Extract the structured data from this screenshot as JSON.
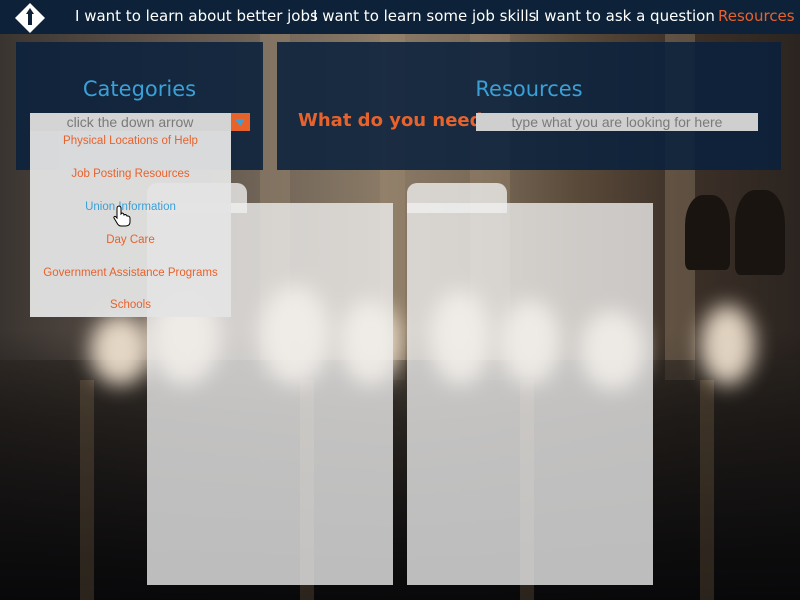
{
  "nav": {
    "items": [
      {
        "label": "I want to learn about better jobs"
      },
      {
        "label": "I want to learn some job skills"
      },
      {
        "label": "I want to ask a question"
      },
      {
        "label": "Resources"
      }
    ],
    "active_color": "#e8622c"
  },
  "categories": {
    "title": "Categories",
    "select_placeholder": "click the down arrow",
    "options": [
      "Physical Locations of Help",
      "Job Posting Resources",
      "Union Information",
      "Day Care",
      "Government Assistance Programs",
      "Schools"
    ],
    "hovered_option": "Union Information"
  },
  "resources": {
    "title": "Resources",
    "need_label": "What do you need:",
    "search_placeholder": "type what you are looking for here"
  },
  "colors": {
    "panel_bg": "#0a213c",
    "accent_blue": "#3aa0d8",
    "accent_orange": "#e8622c"
  }
}
